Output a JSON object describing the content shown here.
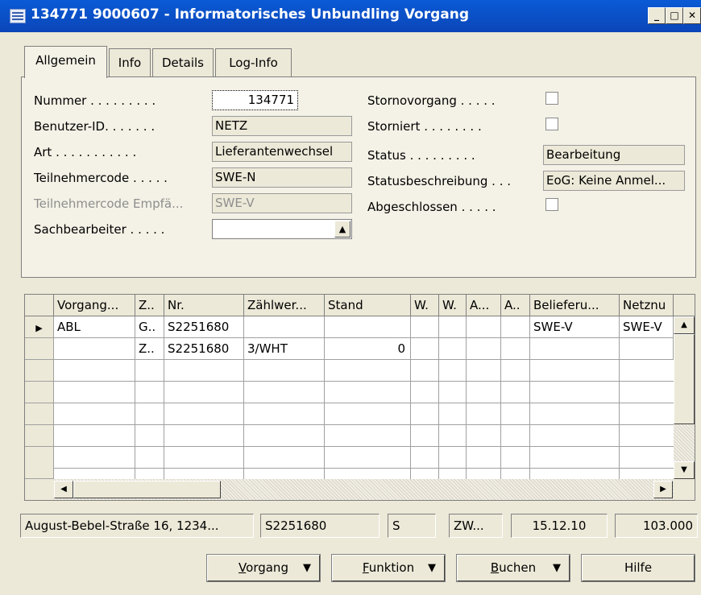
{
  "window": {
    "title": "134771 9000607 - Informatorisches Unbundling Vorgang",
    "icon": "table-icon",
    "controls": [
      "minimize",
      "maximize",
      "close"
    ]
  },
  "tabs": [
    {
      "label": "Allgemein",
      "active": true
    },
    {
      "label": "Info",
      "active": false
    },
    {
      "label": "Details",
      "active": false
    },
    {
      "label": "Log-Info",
      "active": false
    }
  ],
  "form": {
    "nummer": {
      "label": "Nummer . . . . . . . . .",
      "value": "134771"
    },
    "benutzer": {
      "label": "Benutzer-ID. . . . . . .",
      "value": "NETZ"
    },
    "art": {
      "label": "Art . . . . . . . . . . .",
      "value": "Lieferantenwechsel"
    },
    "teilnehmer": {
      "label": "Teilnehmercode . . . . .",
      "value": "SWE-N"
    },
    "teilnehmer_empf": {
      "label": "Teilnehmercode Empfä...",
      "value": "SWE-V"
    },
    "sachbearbeiter": {
      "label": "Sachbearbeiter . . . . .",
      "value": ""
    },
    "stornovorgang": {
      "label": "Stornovorgang . . . . .",
      "checked": false
    },
    "storniert": {
      "label": "Storniert . . . . . . . .",
      "checked": false
    },
    "status": {
      "label": "Status . . . . . . . . .",
      "value": "Bearbeitung"
    },
    "statusbeschreibung": {
      "label": "Statusbeschreibung . . .",
      "value": "EoG: Keine Anmel..."
    },
    "abgeschlossen": {
      "label": "Abgeschlossen . . . . .",
      "checked": false
    }
  },
  "grid": {
    "columns": [
      "Vorgang...",
      "Z..",
      "Nr.",
      "Zählwer...",
      "Stand",
      "W.",
      "W.",
      "A...",
      "A..",
      "Belieferu...",
      "Netznu"
    ],
    "rows": [
      [
        "ABL",
        "G..",
        "S2251680",
        "",
        "",
        "",
        "",
        "",
        "",
        "SWE-V",
        "SWE-V"
      ],
      [
        "",
        "Z..",
        "S2251680",
        "3/WHT",
        "0",
        "",
        "",
        "",
        "",
        "",
        ""
      ]
    ]
  },
  "statusbar": [
    "August-Bebel-Straße 16, 1234...",
    "S2251680",
    "S",
    "ZW...",
    "15.12.10",
    "103.000"
  ],
  "buttons": {
    "vorgang": {
      "first": "V",
      "rest": "organg"
    },
    "funktion": {
      "first": "F",
      "rest": "unktion"
    },
    "buchen": {
      "first": "B",
      "rest": "uchen"
    },
    "hilfe": "Hilfe"
  }
}
